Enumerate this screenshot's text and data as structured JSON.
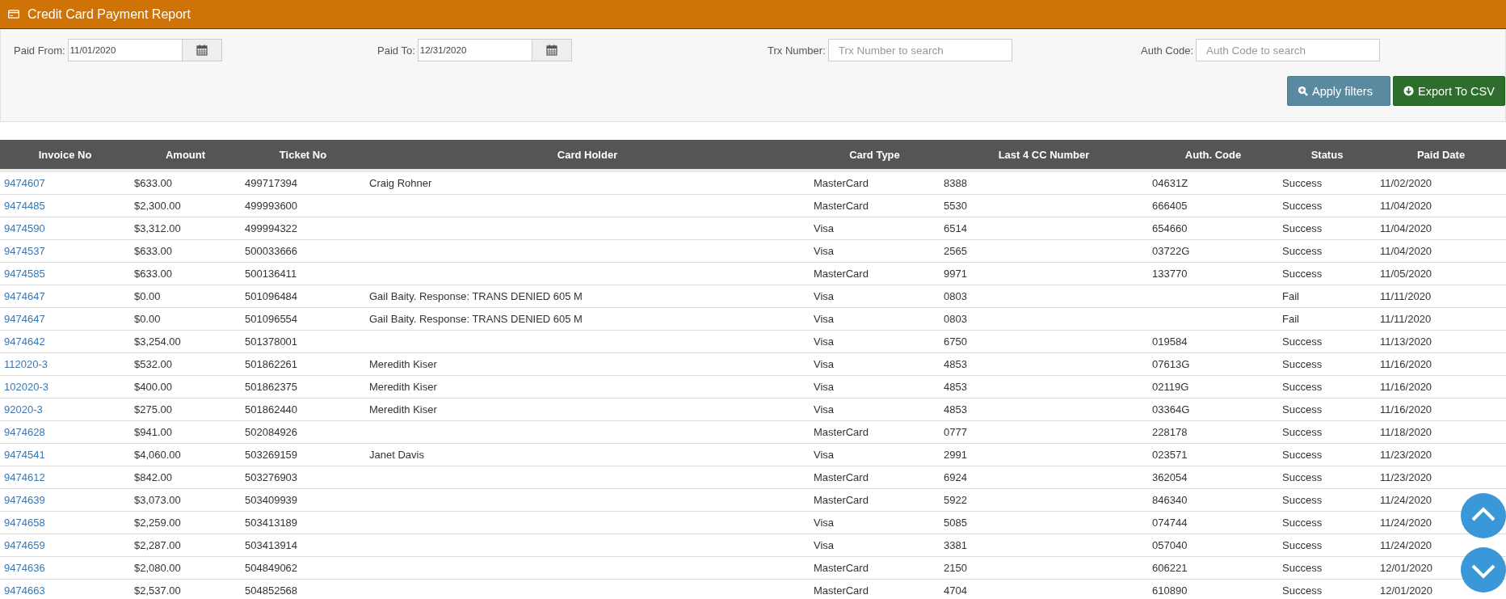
{
  "panel": {
    "title": "Credit Card Payment Report"
  },
  "filters": [
    {
      "kind": "date",
      "label": "Paid From:",
      "value": "11/01/2020"
    },
    {
      "kind": "date",
      "label": "Paid To:",
      "value": "12/31/2020"
    },
    {
      "kind": "text",
      "label": "Trx Number:",
      "placeholder": "Trx Number to search"
    },
    {
      "kind": "text",
      "label": "Auth Code:",
      "placeholder": "Auth Code to search"
    }
  ],
  "buttons": [
    {
      "kind": "apply",
      "label": "Apply filters"
    },
    {
      "kind": "export",
      "label": "Export To CSV"
    }
  ],
  "table": {
    "columns": [
      "Invoice No",
      "Amount",
      "Ticket No",
      "Card Holder",
      "Card Type",
      "Last 4 CC Number",
      "Auth. Code",
      "Status",
      "Paid Date"
    ],
    "rows": [
      {
        "invoice_no": "9474607",
        "amount": "$633.00",
        "ticket_no": "499717394",
        "card_holder": "Craig Rohner",
        "card_type": "MasterCard",
        "last_4": "8388",
        "auth_code": "04631Z",
        "status": "Success",
        "paid_date": "11/02/2020"
      },
      {
        "invoice_no": "9474485",
        "amount": "$2,300.00",
        "ticket_no": "499993600",
        "card_type": "MasterCard",
        "last_4": "5530",
        "auth_code": "666405",
        "status": "Success",
        "paid_date": "11/04/2020"
      },
      {
        "invoice_no": "9474590",
        "amount": "$3,312.00",
        "ticket_no": "499994322",
        "card_type": "Visa",
        "last_4": "6514",
        "auth_code": "654660",
        "status": "Success",
        "paid_date": "11/04/2020"
      },
      {
        "invoice_no": "9474537",
        "amount": "$633.00",
        "ticket_no": "500033666",
        "card_type": "Visa",
        "last_4": "2565",
        "auth_code": "03722G",
        "status": "Success",
        "paid_date": "11/04/2020"
      },
      {
        "invoice_no": "9474585",
        "amount": "$633.00",
        "ticket_no": "500136411",
        "card_type": "MasterCard",
        "last_4": "9971",
        "auth_code": "133770",
        "status": "Success",
        "paid_date": "11/05/2020"
      },
      {
        "invoice_no": "9474647",
        "amount": "$0.00",
        "ticket_no": "501096484",
        "card_holder": "Gail Baity. Response: TRANS DENIED 605 M",
        "card_type": "Visa",
        "last_4": "0803",
        "status": "Fail",
        "paid_date": "11/11/2020"
      },
      {
        "invoice_no": "9474647",
        "amount": "$0.00",
        "ticket_no": "501096554",
        "card_holder": "Gail Baity. Response: TRANS DENIED 605 M",
        "card_type": "Visa",
        "last_4": "0803",
        "status": "Fail",
        "paid_date": "11/11/2020"
      },
      {
        "invoice_no": "9474642",
        "amount": "$3,254.00",
        "ticket_no": "501378001",
        "card_type": "Visa",
        "last_4": "6750",
        "auth_code": "019584",
        "status": "Success",
        "paid_date": "11/13/2020"
      },
      {
        "invoice_no": "112020-3",
        "amount": "$532.00",
        "ticket_no": "501862261",
        "card_holder": "Meredith Kiser",
        "card_type": "Visa",
        "last_4": "4853",
        "auth_code": "07613G",
        "status": "Success",
        "paid_date": "11/16/2020"
      },
      {
        "invoice_no": "102020-3",
        "amount": "$400.00",
        "ticket_no": "501862375",
        "card_holder": "Meredith Kiser",
        "card_type": "Visa",
        "last_4": "4853",
        "auth_code": "02119G",
        "status": "Success",
        "paid_date": "11/16/2020"
      },
      {
        "invoice_no": "92020-3",
        "amount": "$275.00",
        "ticket_no": "501862440",
        "card_holder": "Meredith Kiser",
        "card_type": "Visa",
        "last_4": "4853",
        "auth_code": "03364G",
        "status": "Success",
        "paid_date": "11/16/2020"
      },
      {
        "invoice_no": "9474628",
        "amount": "$941.00",
        "ticket_no": "502084926",
        "card_type": "MasterCard",
        "last_4": "0777",
        "auth_code": "228178",
        "status": "Success",
        "paid_date": "11/18/2020"
      },
      {
        "invoice_no": "9474541",
        "amount": "$4,060.00",
        "ticket_no": "503269159",
        "card_holder": "Janet Davis",
        "card_type": "Visa",
        "last_4": "2991",
        "auth_code": "023571",
        "status": "Success",
        "paid_date": "11/23/2020"
      },
      {
        "invoice_no": "9474612",
        "amount": "$842.00",
        "ticket_no": "503276903",
        "card_type": "MasterCard",
        "last_4": "6924",
        "auth_code": "362054",
        "status": "Success",
        "paid_date": "11/23/2020"
      },
      {
        "invoice_no": "9474639",
        "amount": "$3,073.00",
        "ticket_no": "503409939",
        "card_type": "MasterCard",
        "last_4": "5922",
        "auth_code": "846340",
        "status": "Success",
        "paid_date": "11/24/2020"
      },
      {
        "invoice_no": "9474658",
        "amount": "$2,259.00",
        "ticket_no": "503413189",
        "card_type": "Visa",
        "last_4": "5085",
        "auth_code": "074744",
        "status": "Success",
        "paid_date": "11/24/2020"
      },
      {
        "invoice_no": "9474659",
        "amount": "$2,287.00",
        "ticket_no": "503413914",
        "card_type": "Visa",
        "last_4": "3381",
        "auth_code": "057040",
        "status": "Success",
        "paid_date": "11/24/2020"
      },
      {
        "invoice_no": "9474636",
        "amount": "$2,080.00",
        "ticket_no": "504849062",
        "card_type": "MasterCard",
        "last_4": "2150",
        "auth_code": "606221",
        "status": "Success",
        "paid_date": "12/01/2020"
      },
      {
        "invoice_no": "9474663",
        "amount": "$2,537.00",
        "ticket_no": "504852568",
        "card_type": "MasterCard",
        "last_4": "4704",
        "auth_code": "610890",
        "status": "Success",
        "paid_date": "12/01/2020"
      }
    ]
  }
}
